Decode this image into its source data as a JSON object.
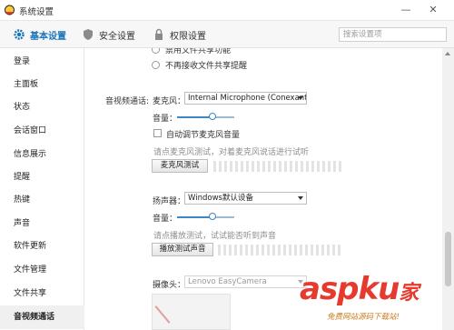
{
  "window": {
    "title": "系统设置"
  },
  "tabs": [
    {
      "label": "基本设置",
      "icon": "gear-icon",
      "active": true
    },
    {
      "label": "安全设置",
      "icon": "shield-icon",
      "active": false
    },
    {
      "label": "权限设置",
      "icon": "lock-icon",
      "active": false
    }
  ],
  "search": {
    "placeholder": "搜索设置项"
  },
  "sidebar": {
    "items": [
      {
        "label": "登录"
      },
      {
        "label": "主面板"
      },
      {
        "label": "状态"
      },
      {
        "label": "会话窗口"
      },
      {
        "label": "信息展示"
      },
      {
        "label": "提醒"
      },
      {
        "label": "热键"
      },
      {
        "label": "声音"
      },
      {
        "label": "软件更新"
      },
      {
        "label": "文件管理"
      },
      {
        "label": "文件共享"
      },
      {
        "label": "音视频通话"
      }
    ],
    "active": "音视频通话"
  },
  "file_share": {
    "option_top": "禁用文件共享功能",
    "option_no_notify": "不再接收文件共享提醒"
  },
  "av": {
    "section_label": "音视频通话:",
    "mic": {
      "label": "麦克风：",
      "device": "Internal Microphone (Conexant ...",
      "volume_label": "音量：",
      "volume": 0.62,
      "auto_adjust_label": "自动调节麦克风音量",
      "auto_adjust": false,
      "hint": "请点麦克风测试，对着麦克风说话进行试听",
      "test_button": "麦克风测试"
    },
    "speaker": {
      "label": "扬声器：",
      "device": "Windows默认设备",
      "volume_label": "音量：",
      "volume": 0.62,
      "hint": "请点播放测试，试试能否听到声音",
      "test_button": "播放测试声音"
    },
    "camera": {
      "label": "摄像头：",
      "device": "Lenovo EasyCamera"
    }
  },
  "watermark": {
    "text": "aspku",
    "suffix": "家",
    "subtitle": "免费网站源码下载站!"
  }
}
